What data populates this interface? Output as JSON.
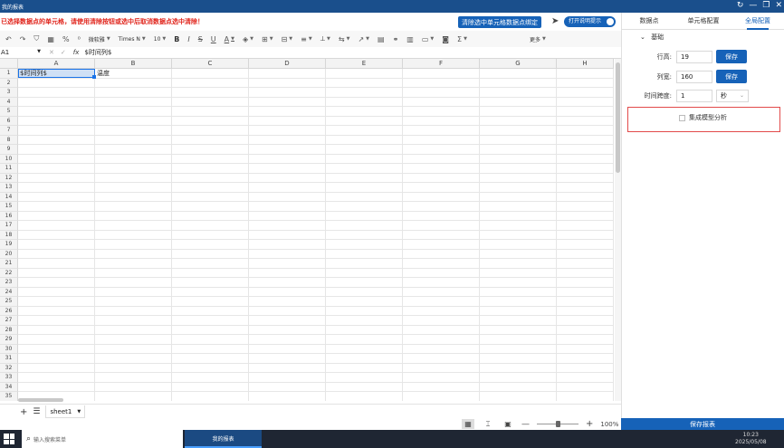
{
  "window": {
    "title": "我的报表",
    "controls": [
      "↻",
      "—",
      "❐",
      "✕"
    ]
  },
  "alert": {
    "message": "已选择数据点的单元格，请使用清除按钮或选中后取消数据点选中清除！",
    "clear_button": "清除选中单元格数据点绑定",
    "toggle_label": "打开说明提示"
  },
  "toolbar": {
    "font_family_a": "微软雅",
    "font_family_b": "Times N",
    "font_size": "10",
    "more": "更多"
  },
  "formula_bar": {
    "name_box": "A1",
    "fx": "fx",
    "content": "$时间列$"
  },
  "grid": {
    "columns": [
      "A",
      "B",
      "C",
      "D",
      "E",
      "F",
      "G",
      "H"
    ],
    "rows": [
      "1",
      "2",
      "3",
      "4",
      "5",
      "6",
      "7",
      "8",
      "9",
      "10",
      "11",
      "12",
      "13",
      "14",
      "15",
      "16",
      "17",
      "18",
      "19",
      "20",
      "21",
      "22",
      "23",
      "24",
      "25",
      "26",
      "27",
      "28",
      "29",
      "30",
      "31",
      "32",
      "33",
      "34",
      "35"
    ],
    "cells": {
      "A1": "$时间列$",
      "B1": "温度"
    }
  },
  "sheets": {
    "tabs": [
      "sheet1"
    ],
    "zoom": "100%"
  },
  "panel": {
    "tabs": [
      "数据点",
      "单元格配置",
      "全局配置"
    ],
    "active_tab": "全局配置",
    "section": "基础",
    "row_height_label": "行高:",
    "row_height_value": "19",
    "col_width_label": "列宽:",
    "col_width_value": "160",
    "time_span_label": "时间跨度:",
    "time_span_value": "1",
    "time_unit": "秒",
    "save_label": "保存",
    "integrated_model_label": "集成模型分析",
    "save_report": "保存报表"
  },
  "taskbar": {
    "search_placeholder": "输入搜索菜单",
    "app": "我的报表",
    "time": "10:23",
    "date": "2025/05/08"
  }
}
